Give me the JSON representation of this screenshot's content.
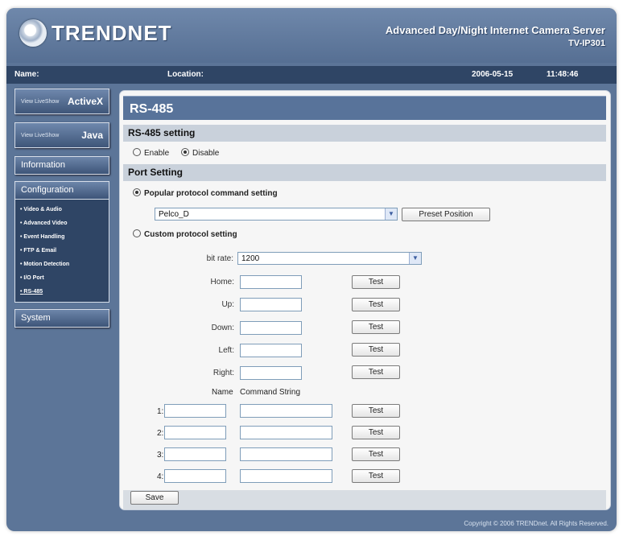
{
  "header": {
    "logo_text": "TRENDNET",
    "product_title": "Advanced Day/Night Internet Camera Server",
    "model": "TV-IP301"
  },
  "infobar": {
    "name_label": "Name:",
    "location_label": "Location:",
    "date": "2006-05-15",
    "time": "11:48:46"
  },
  "sidebar": {
    "activex": {
      "small": "View LiveShow",
      "big": "ActiveX"
    },
    "java": {
      "small": "View LiveShow",
      "big": "Java"
    },
    "information": "Information",
    "configuration": "Configuration",
    "config_items": [
      "Video & Audio",
      "Advanced Video",
      "Event Handling",
      "FTP & Email",
      "Motion Detection",
      "I/O Port",
      "RS-485"
    ],
    "system": "System"
  },
  "page": {
    "title": "RS-485",
    "setting_section": "RS-485 setting",
    "enable_label": "Enable",
    "disable_label": "Disable",
    "port_section": "Port Setting",
    "popular_label": "Popular protocol command setting",
    "protocol_value": "Pelco_D",
    "preset_button": "Preset Position",
    "custom_label": "Custom protocol setting",
    "bitrate_label": "bit rate:",
    "bitrate_value": "1200",
    "direction_labels": [
      "Home:",
      "Up:",
      "Down:",
      "Left:",
      "Right:"
    ],
    "test_label": "Test",
    "name_header": "Name",
    "command_header": "Command String",
    "row_numbers": [
      "1:",
      "2:",
      "3:",
      "4:"
    ],
    "save_button": "Save"
  },
  "footer": {
    "copyright": "Copyright © 2006 TRENDnet. All Rights Reserved."
  }
}
